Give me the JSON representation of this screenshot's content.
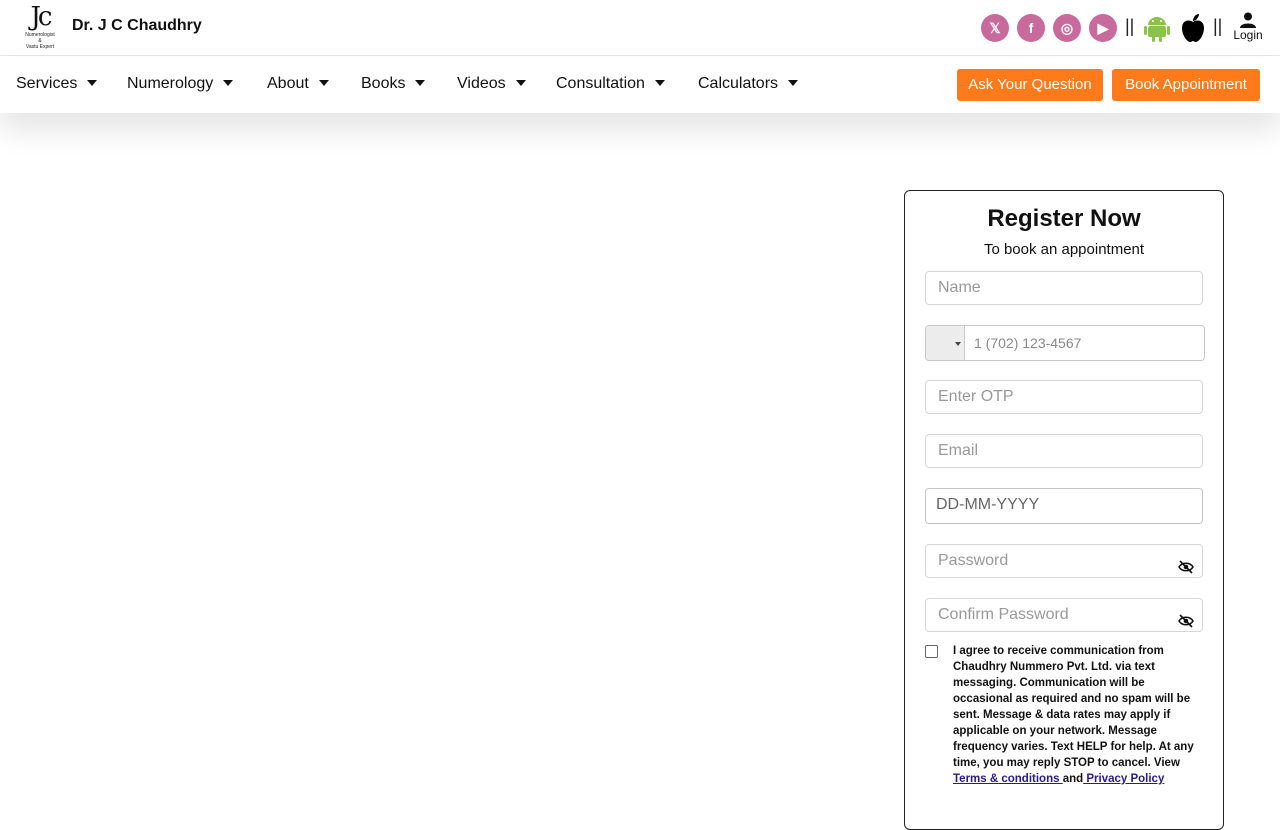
{
  "header": {
    "logo_mono": "Jc",
    "logo_subtitle_1": "Numerologist",
    "logo_subtitle_2": "&",
    "logo_subtitle_3": "Vastu Expert",
    "brand": "Dr. J C Chaudhry",
    "social": [
      {
        "name": "x",
        "glyph": "𝕏"
      },
      {
        "name": "facebook",
        "glyph": "f"
      },
      {
        "name": "instagram",
        "glyph": "◎"
      },
      {
        "name": "youtube",
        "glyph": "▶"
      }
    ],
    "separator": "||",
    "login_label": "Login",
    "social_color": "#c86a9b",
    "android_color": "#8bc34a"
  },
  "nav": {
    "items": [
      "Services",
      "Numerology",
      "About",
      "Books",
      "Videos",
      "Consultation",
      "Calculators"
    ],
    "ask_button": "Ask Your Question",
    "book_button": "Book Appointment",
    "accent": "#ff7a1a"
  },
  "register": {
    "title": "Register Now",
    "subtitle": "To book an appointment",
    "name_placeholder": "Name",
    "phone_placeholder": "1 (702) 123-4567",
    "otp_placeholder": "Enter OTP",
    "email_placeholder": "Email",
    "dob_placeholder": "DD-MM-YYYY",
    "password_placeholder": "Password",
    "confirm_password_placeholder": "Confirm Password",
    "consent_text": "I agree to receive communication from Chaudhry Nummero Pvt. Ltd. via text messaging. Communication will be occasional as required and no spam will be sent. Message & data rates may apply if applicable on your network. Message frequency varies. Text HELP for help. At any time, you may reply STOP to cancel. View",
    "terms_link": " Terms & conditions ",
    "and_text": "and",
    "privacy_link": " Privacy Policy"
  }
}
